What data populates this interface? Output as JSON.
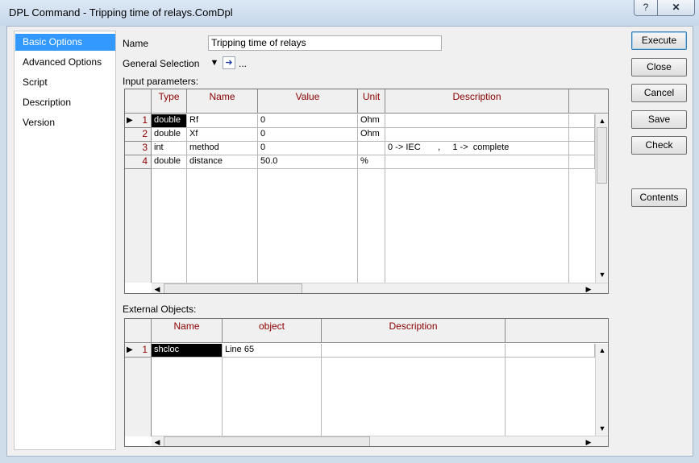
{
  "window": {
    "title": "DPL Command - Tripping time of relays.ComDpl",
    "help_label": "?",
    "close_label": "✕"
  },
  "nav": {
    "items": [
      {
        "label": "Basic Options",
        "selected": true
      },
      {
        "label": "Advanced Options",
        "selected": false
      },
      {
        "label": "Script",
        "selected": false
      },
      {
        "label": "Description",
        "selected": false
      },
      {
        "label": "Version",
        "selected": false
      }
    ]
  },
  "form": {
    "name_label": "Name",
    "name_value": "Tripping time of relays",
    "general_selection_label": "General Selection",
    "general_selection_more": "...",
    "input_params_label": "Input parameters:",
    "external_objects_label": "External Objects:"
  },
  "input_params": {
    "columns": [
      "Type",
      "Name",
      "Value",
      "Unit",
      "Description"
    ],
    "rows": [
      {
        "num": "1",
        "type": "double",
        "name": "Rf",
        "value": "0",
        "unit": "Ohm",
        "description": ""
      },
      {
        "num": "2",
        "type": "double",
        "name": "Xf",
        "value": "0",
        "unit": "Ohm",
        "description": ""
      },
      {
        "num": "3",
        "type": "int",
        "name": "method",
        "value": "0",
        "unit": "",
        "description": "0 -> IEC       ,     1 ->  complete"
      },
      {
        "num": "4",
        "type": "double",
        "name": "distance",
        "value": "50.0",
        "unit": "%",
        "description": ""
      }
    ]
  },
  "external_objects": {
    "columns": [
      "Name",
      "object",
      "Description"
    ],
    "rows": [
      {
        "num": "1",
        "name": "shcloc",
        "object": "Line 65",
        "description": ""
      }
    ]
  },
  "buttons": {
    "execute": "Execute",
    "close": "Close",
    "cancel": "Cancel",
    "save": "Save",
    "check": "Check",
    "contents": "Contents"
  },
  "icons": {
    "row_pointer": "pointer-right-icon",
    "scroll_up": "arrow-up-icon",
    "scroll_down": "arrow-down-icon",
    "scroll_left": "arrow-left-icon",
    "scroll_right": "arrow-right-icon"
  }
}
